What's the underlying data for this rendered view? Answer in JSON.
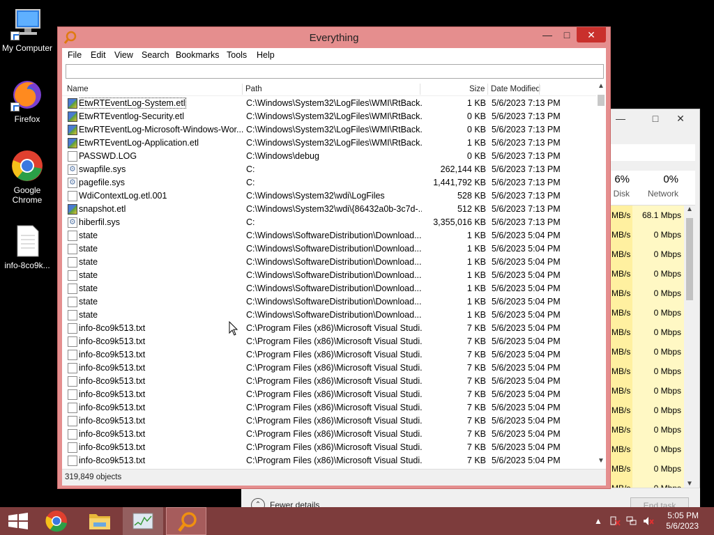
{
  "desktop": {
    "icons": [
      {
        "label": "My Computer"
      },
      {
        "label": "Firefox"
      },
      {
        "label": "Google Chrome"
      },
      {
        "label": "info-8co9k..."
      }
    ]
  },
  "everything": {
    "title": "Everything",
    "menu": [
      "File",
      "Edit",
      "View",
      "Search",
      "Bookmarks",
      "Tools",
      "Help"
    ],
    "search_value": "",
    "columns": {
      "name": "Name",
      "path": "Path",
      "size": "Size",
      "date": "Date Modified"
    },
    "rows": [
      {
        "icon": "etl-file-icon",
        "name": "EtwRTEventLog-System.etl",
        "path": "C:\\Windows\\System32\\LogFiles\\WMI\\RtBack...",
        "size": "1 KB",
        "date": "5/6/2023 7:13 PM"
      },
      {
        "icon": "etl-file-icon",
        "name": "EtwRTEventlog-Security.etl",
        "path": "C:\\Windows\\System32\\LogFiles\\WMI\\RtBack...",
        "size": "0 KB",
        "date": "5/6/2023 7:13 PM"
      },
      {
        "icon": "etl-file-icon",
        "name": "EtwRTEventLog-Microsoft-Windows-Wor...",
        "path": "C:\\Windows\\System32\\LogFiles\\WMI\\RtBack...",
        "size": "0 KB",
        "date": "5/6/2023 7:13 PM"
      },
      {
        "icon": "etl-file-icon",
        "name": "EtwRTEventLog-Application.etl",
        "path": "C:\\Windows\\System32\\LogFiles\\WMI\\RtBack...",
        "size": "1 KB",
        "date": "5/6/2023 7:13 PM"
      },
      {
        "icon": "text-file-icon",
        "name": "PASSWD.LOG",
        "path": "C:\\Windows\\debug",
        "size": "0 KB",
        "date": "5/6/2023 7:13 PM"
      },
      {
        "icon": "system-file-icon",
        "name": "swapfile.sys",
        "path": "C:",
        "size": "262,144 KB",
        "date": "5/6/2023 7:13 PM"
      },
      {
        "icon": "system-file-icon",
        "name": "pagefile.sys",
        "path": "C:",
        "size": "1,441,792 KB",
        "date": "5/6/2023 7:13 PM"
      },
      {
        "icon": "text-file-icon",
        "name": "WdiContextLog.etl.001",
        "path": "C:\\Windows\\System32\\wdi\\LogFiles",
        "size": "528 KB",
        "date": "5/6/2023 7:13 PM"
      },
      {
        "icon": "etl-file-icon",
        "name": "snapshot.etl",
        "path": "C:\\Windows\\System32\\wdi\\{86432a0b-3c7d-...",
        "size": "512 KB",
        "date": "5/6/2023 7:13 PM"
      },
      {
        "icon": "system-file-icon",
        "name": "hiberfil.sys",
        "path": "C:",
        "size": "3,355,016 KB",
        "date": "5/6/2023 7:13 PM"
      },
      {
        "icon": "text-file-icon",
        "name": "state",
        "path": "C:\\Windows\\SoftwareDistribution\\Download...",
        "size": "1 KB",
        "date": "5/6/2023 5:04 PM"
      },
      {
        "icon": "text-file-icon",
        "name": "state",
        "path": "C:\\Windows\\SoftwareDistribution\\Download...",
        "size": "1 KB",
        "date": "5/6/2023 5:04 PM"
      },
      {
        "icon": "text-file-icon",
        "name": "state",
        "path": "C:\\Windows\\SoftwareDistribution\\Download...",
        "size": "1 KB",
        "date": "5/6/2023 5:04 PM"
      },
      {
        "icon": "text-file-icon",
        "name": "state",
        "path": "C:\\Windows\\SoftwareDistribution\\Download...",
        "size": "1 KB",
        "date": "5/6/2023 5:04 PM"
      },
      {
        "icon": "text-file-icon",
        "name": "state",
        "path": "C:\\Windows\\SoftwareDistribution\\Download...",
        "size": "1 KB",
        "date": "5/6/2023 5:04 PM"
      },
      {
        "icon": "text-file-icon",
        "name": "state",
        "path": "C:\\Windows\\SoftwareDistribution\\Download...",
        "size": "1 KB",
        "date": "5/6/2023 5:04 PM"
      },
      {
        "icon": "text-file-icon",
        "name": "state",
        "path": "C:\\Windows\\SoftwareDistribution\\Download...",
        "size": "1 KB",
        "date": "5/6/2023 5:04 PM"
      },
      {
        "icon": "text-file-icon",
        "name": "info-8co9k513.txt",
        "path": "C:\\Program Files (x86)\\Microsoft Visual Studi...",
        "size": "7 KB",
        "date": "5/6/2023 5:04 PM"
      },
      {
        "icon": "text-file-icon",
        "name": "info-8co9k513.txt",
        "path": "C:\\Program Files (x86)\\Microsoft Visual Studi...",
        "size": "7 KB",
        "date": "5/6/2023 5:04 PM"
      },
      {
        "icon": "text-file-icon",
        "name": "info-8co9k513.txt",
        "path": "C:\\Program Files (x86)\\Microsoft Visual Studi...",
        "size": "7 KB",
        "date": "5/6/2023 5:04 PM"
      },
      {
        "icon": "text-file-icon",
        "name": "info-8co9k513.txt",
        "path": "C:\\Program Files (x86)\\Microsoft Visual Studi...",
        "size": "7 KB",
        "date": "5/6/2023 5:04 PM"
      },
      {
        "icon": "text-file-icon",
        "name": "info-8co9k513.txt",
        "path": "C:\\Program Files (x86)\\Microsoft Visual Studi...",
        "size": "7 KB",
        "date": "5/6/2023 5:04 PM"
      },
      {
        "icon": "text-file-icon",
        "name": "info-8co9k513.txt",
        "path": "C:\\Program Files (x86)\\Microsoft Visual Studi...",
        "size": "7 KB",
        "date": "5/6/2023 5:04 PM"
      },
      {
        "icon": "text-file-icon",
        "name": "info-8co9k513.txt",
        "path": "C:\\Program Files (x86)\\Microsoft Visual Studi...",
        "size": "7 KB",
        "date": "5/6/2023 5:04 PM"
      },
      {
        "icon": "text-file-icon",
        "name": "info-8co9k513.txt",
        "path": "C:\\Program Files (x86)\\Microsoft Visual Studi...",
        "size": "7 KB",
        "date": "5/6/2023 5:04 PM"
      },
      {
        "icon": "text-file-icon",
        "name": "info-8co9k513.txt",
        "path": "C:\\Program Files (x86)\\Microsoft Visual Studi...",
        "size": "7 KB",
        "date": "5/6/2023 5:04 PM"
      },
      {
        "icon": "text-file-icon",
        "name": "info-8co9k513.txt",
        "path": "C:\\Program Files (x86)\\Microsoft Visual Studi...",
        "size": "7 KB",
        "date": "5/6/2023 5:04 PM"
      },
      {
        "icon": "text-file-icon",
        "name": "info-8co9k513.txt",
        "path": "C:\\Program Files (x86)\\Microsoft Visual Studi...",
        "size": "7 KB",
        "date": "5/6/2023 5:04 PM"
      }
    ],
    "status": "319,849 objects"
  },
  "task_manager": {
    "disk_percent": "6%",
    "disk_label": "Disk",
    "network_percent": "0%",
    "network_label": "Network",
    "rows": [
      {
        "disk": "MB/s",
        "network": "68.1 Mbps"
      },
      {
        "disk": "MB/s",
        "network": "0 Mbps"
      },
      {
        "disk": "MB/s",
        "network": "0 Mbps"
      },
      {
        "disk": "MB/s",
        "network": "0 Mbps"
      },
      {
        "disk": "MB/s",
        "network": "0 Mbps"
      },
      {
        "disk": "MB/s",
        "network": "0 Mbps"
      },
      {
        "disk": "MB/s",
        "network": "0 Mbps"
      },
      {
        "disk": "MB/s",
        "network": "0 Mbps"
      },
      {
        "disk": "MB/s",
        "network": "0 Mbps"
      },
      {
        "disk": "MB/s",
        "network": "0 Mbps"
      },
      {
        "disk": "MB/s",
        "network": "0 Mbps"
      },
      {
        "disk": "MB/s",
        "network": "0 Mbps"
      },
      {
        "disk": "MB/s",
        "network": "0 Mbps"
      },
      {
        "disk": "MB/s",
        "network": "0 Mbps"
      },
      {
        "disk": "MB/s",
        "network": "0 Mbps"
      }
    ],
    "fewer_details": "Fewer details",
    "end_task": "End task"
  },
  "taskbar": {
    "time": "5:05 PM",
    "date": "5/6/2023"
  },
  "colors": {
    "everything_frame": "#e58e8e",
    "taskbar": "#7d3c3c",
    "close_button": "#c9302c"
  }
}
